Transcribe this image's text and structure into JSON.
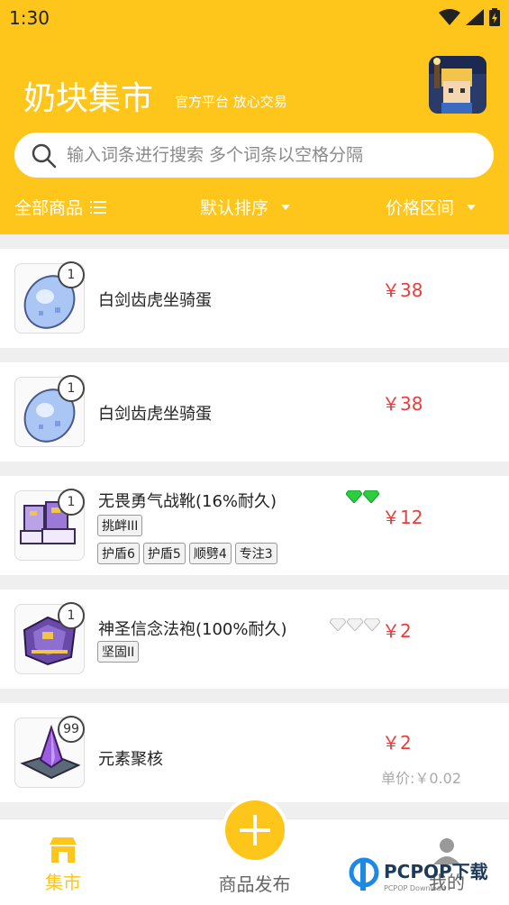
{
  "status": {
    "time": "1:30"
  },
  "header": {
    "title": "奶块集市",
    "subtitle": "官方平台 放心交易",
    "avatar_icon": "player-avatar-icon"
  },
  "search": {
    "placeholder": "输入词条进行搜索 多个词条以空格分隔"
  },
  "filters": {
    "all": "全部商品",
    "sort": "默认排序",
    "price": "价格区间"
  },
  "items": [
    {
      "name": "白剑齿虎坐骑蛋",
      "price": "￥38",
      "qty": "1",
      "icon": "egg-icon",
      "tags_row1": [],
      "tags_row2": []
    },
    {
      "name": "白剑齿虎坐骑蛋",
      "price": "￥38",
      "qty": "1",
      "icon": "egg-icon",
      "tags_row1": [],
      "tags_row2": []
    },
    {
      "name": "无畏勇气战靴(16%耐久)",
      "price": "￥12",
      "qty": "1",
      "icon": "boots-icon",
      "gems": "green",
      "tags_row1": [
        "挑衅III"
      ],
      "tags_row2": [
        "护盾6",
        "护盾5",
        "顺劈4",
        "专注3"
      ]
    },
    {
      "name": "神圣信念法袍(100%耐久)",
      "price": "￥2",
      "qty": "1",
      "icon": "robe-icon",
      "gems": "gray",
      "tags_row1": [
        "坚固II"
      ],
      "tags_row2": []
    },
    {
      "name": "元素聚核",
      "price": "￥2",
      "qty": "99",
      "icon": "crystal-icon",
      "unit_price": "单价:￥0.02",
      "tags_row1": [],
      "tags_row2": []
    }
  ],
  "nav": {
    "market": "集市",
    "publish": "商品发布",
    "me": "我的"
  },
  "watermark": {
    "brand": "PCPOP下载",
    "small": "PCPOP Download"
  },
  "colors": {
    "brand": "#fec51a",
    "price": "#e83d3d"
  }
}
